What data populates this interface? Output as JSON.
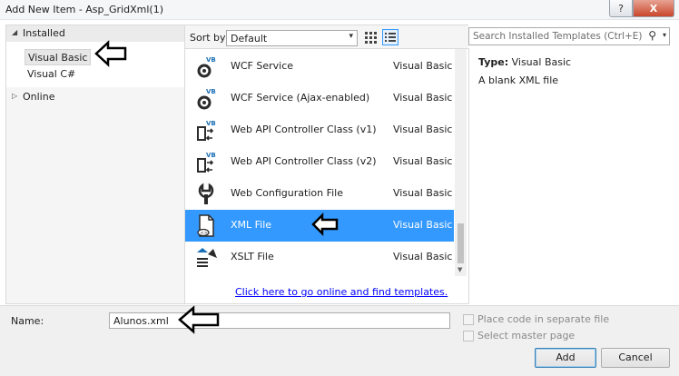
{
  "window": {
    "title": "Add New Item - Asp_GridXml(1)",
    "help_label": "?",
    "close_label": "X"
  },
  "tree": {
    "installed_label": "Installed",
    "items": [
      {
        "label": "Visual Basic",
        "selected": true
      },
      {
        "label": "Visual C#",
        "selected": false
      }
    ],
    "online_label": "Online"
  },
  "sort": {
    "label": "Sort by:",
    "value": "Default"
  },
  "search": {
    "placeholder": "Search Installed Templates (Ctrl+E)"
  },
  "templates": [
    {
      "name": "WCF Service",
      "language": "Visual Basic",
      "icon": "wcf-service-icon"
    },
    {
      "name": "WCF Service (Ajax-enabled)",
      "language": "Visual Basic",
      "icon": "wcf-ajax-service-icon"
    },
    {
      "name": "Web API Controller Class (v1)",
      "language": "Visual Basic",
      "icon": "web-api-controller-icon"
    },
    {
      "name": "Web API Controller Class (v2)",
      "language": "Visual Basic",
      "icon": "web-api-controller-icon"
    },
    {
      "name": "Web Configuration File",
      "language": "Visual Basic",
      "icon": "web-config-icon"
    },
    {
      "name": "XML File",
      "language": "Visual Basic",
      "icon": "xml-file-icon",
      "selected": true
    },
    {
      "name": "XSLT File",
      "language": "Visual Basic",
      "icon": "xslt-file-icon"
    }
  ],
  "online_link": "Click here to go online and find templates.",
  "details": {
    "type_label": "Type:",
    "type_value": "Visual Basic",
    "description": "A blank XML file"
  },
  "form": {
    "name_label": "Name:",
    "name_value": "Alunos.xml",
    "place_code_label": "Place code in separate file",
    "select_master_label": "Select master page",
    "add_label": "Add",
    "cancel_label": "Cancel"
  },
  "colors": {
    "selection": "#3399ff",
    "link": "#0000ff",
    "close_button": "#c9462c"
  }
}
